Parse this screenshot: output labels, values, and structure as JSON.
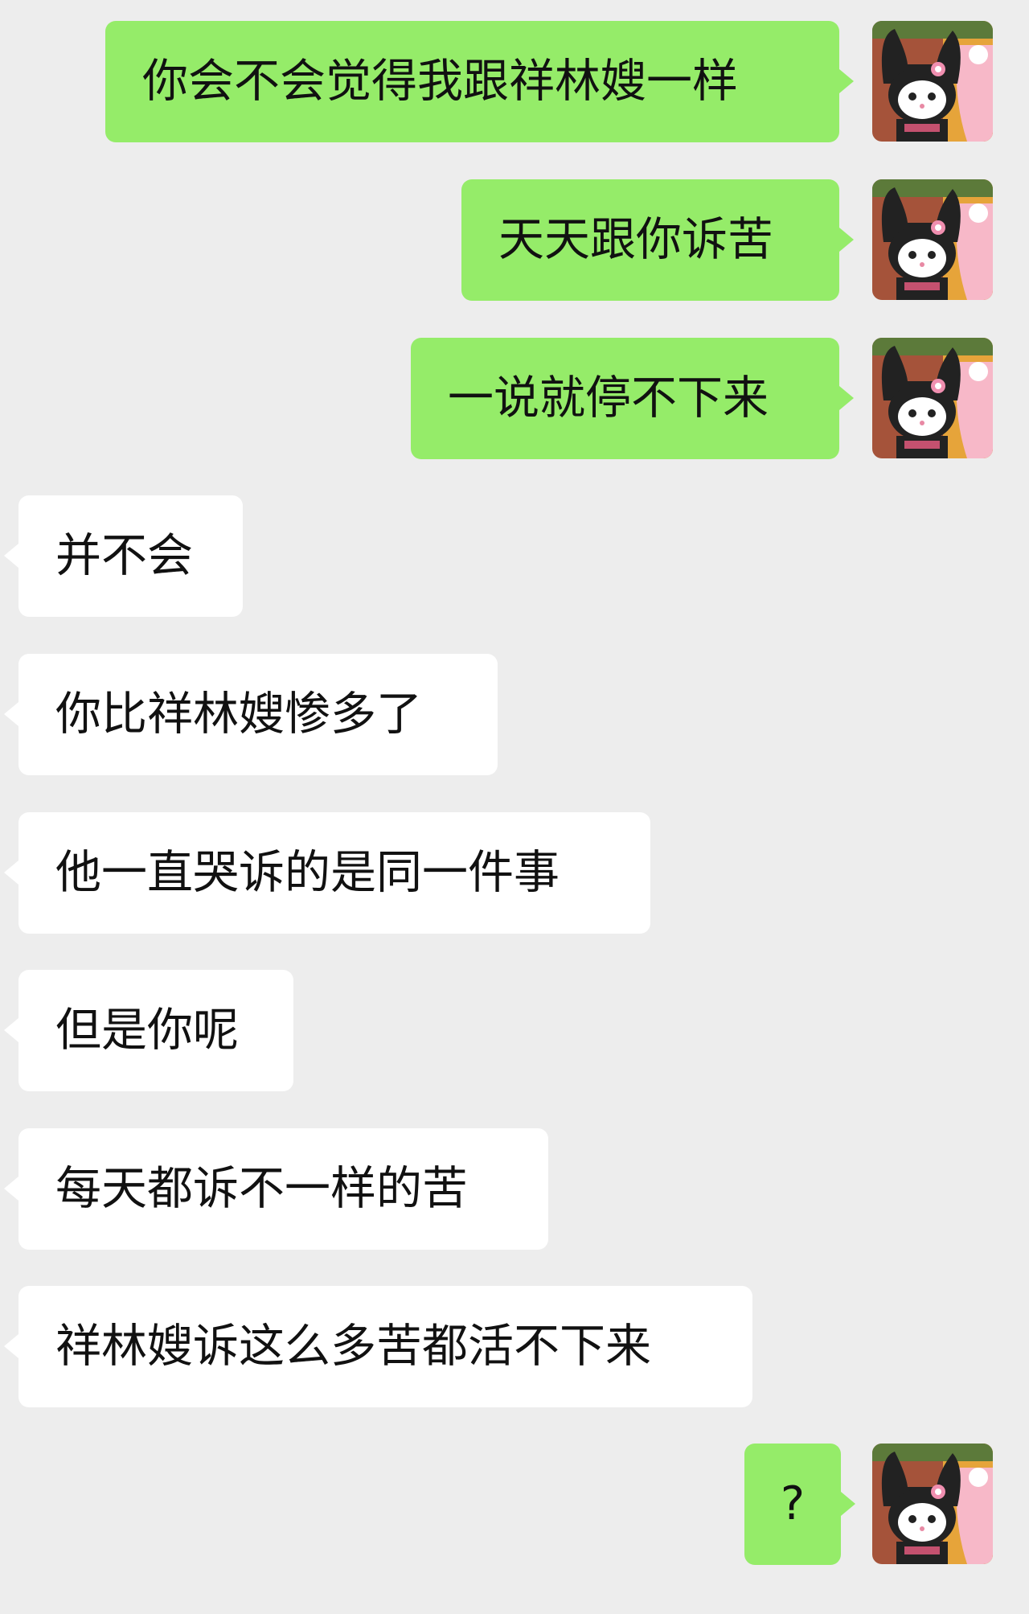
{
  "messages": [
    {
      "side": "me",
      "text": "你会不会觉得我跟祥林嫂一样"
    },
    {
      "side": "me",
      "text": "天天跟你诉苦"
    },
    {
      "side": "me",
      "text": "一说就停不下来"
    },
    {
      "side": "other",
      "text": "并不会"
    },
    {
      "side": "other",
      "text": "你比祥林嫂惨多了"
    },
    {
      "side": "other",
      "text": "他一直哭诉的是同一件事"
    },
    {
      "side": "other",
      "text": "但是你呢"
    },
    {
      "side": "other",
      "text": "每天都诉不一样的苦"
    },
    {
      "side": "other",
      "text": "祥林嫂诉这么多苦都活不下来"
    },
    {
      "side": "me",
      "text": "?"
    }
  ],
  "avatar": {
    "icon": "kuromi-avatar-icon"
  },
  "colors": {
    "background": "#ededed",
    "me_bubble": "#95ec69",
    "other_bubble": "#ffffff",
    "text": "#111111"
  }
}
